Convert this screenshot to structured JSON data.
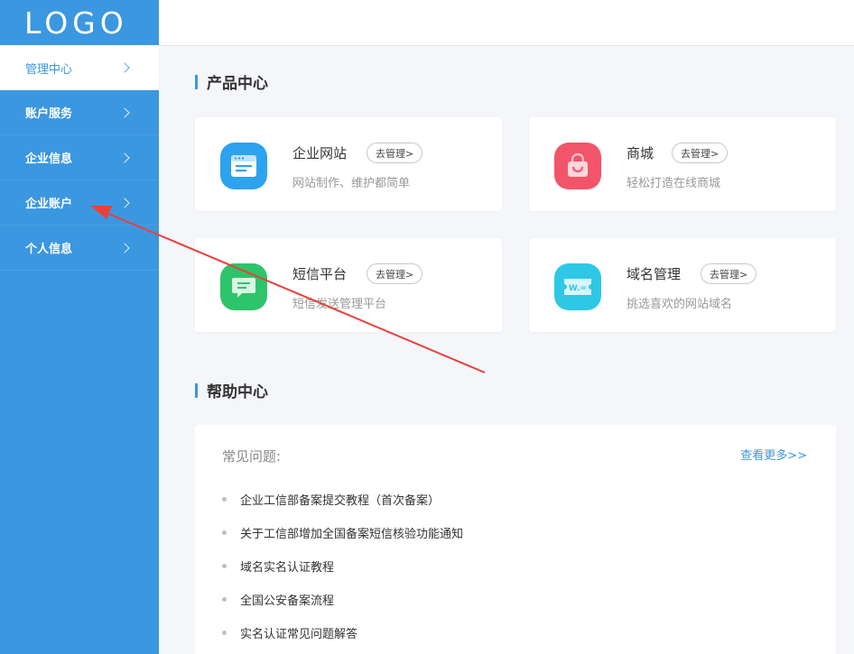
{
  "logo": "LOGO",
  "sidebar": {
    "items": [
      {
        "label": "管理中心"
      },
      {
        "label": "账户服务"
      },
      {
        "label": "企业信息"
      },
      {
        "label": "企业账户"
      },
      {
        "label": "个人信息"
      }
    ]
  },
  "product_center": {
    "title": "产品中心",
    "manage_label": "去管理>",
    "products": [
      {
        "name": "企业网站",
        "desc": "网站制作、维护都简单",
        "icon": "website-icon",
        "color": "#2da3f0"
      },
      {
        "name": "商城",
        "desc": "轻松打造在线商城",
        "icon": "shopping-bag-icon",
        "color": "#f2556a"
      },
      {
        "name": "短信平台",
        "desc": "短信发送管理平台",
        "icon": "message-icon",
        "color": "#2ec46a"
      },
      {
        "name": "域名管理",
        "desc": "挑选喜欢的网站域名",
        "icon": "domain-ticket-icon",
        "color": "#2ec8e6",
        "icon_text": "W.="
      }
    ]
  },
  "help_center": {
    "title": "帮助中心",
    "faq_label": "常见问题:",
    "more_label": "查看更多>>",
    "questions": [
      "企业工信部备案提交教程（首次备案）",
      "关于工信部增加全国备案短信核验功能通知",
      "域名实名认证教程",
      "全国公安备案流程",
      "实名认证常见问题解答"
    ]
  },
  "colors": {
    "sidebar": "#3b97e0",
    "accent": "#3b97e0",
    "annotation_arrow": "#e8413c"
  }
}
